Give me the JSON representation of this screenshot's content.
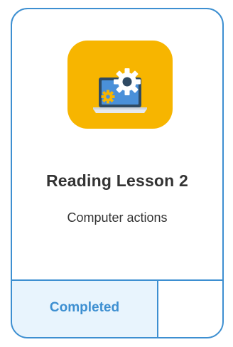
{
  "lesson_card": {
    "title": "Reading Lesson 2",
    "subtitle": "Computer actions",
    "status": "Completed",
    "icon": "laptop-gear-icon"
  },
  "colors": {
    "accent": "#3d8fd1",
    "icon_tile": "#f7b500",
    "status_bg": "#e8f4fd",
    "text": "#333333"
  }
}
